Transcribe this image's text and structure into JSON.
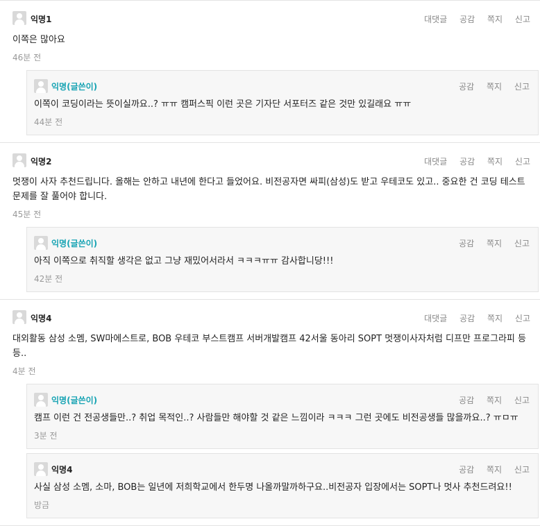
{
  "actions": {
    "reply": "대댓글",
    "like": "공감",
    "message": "쪽지",
    "report": "신고"
  },
  "comments": [
    {
      "author": "익명1",
      "text": "이쪽은 많아요",
      "time": "46분 전",
      "replies": [
        {
          "author": "익명(글쓴이)",
          "text": "이쪽이 코딩이라는 뜻이실까요..? ㅠㅠ 캠퍼스픽 이런 곳은 기자단 서포터즈 같은 것만 있길래요 ㅠㅠ",
          "time": "44분 전"
        }
      ]
    },
    {
      "author": "익명2",
      "text": "멋쟁이 사자 추천드립니다. 올해는 안하고 내년에 한다고 들었어요. 비전공자면 싸피(삼성)도 받고 우테코도 있고.. 중요한 건 코딩 테스트 문제를 잘 풀어야 합니다.",
      "time": "45분 전",
      "replies": [
        {
          "author": "익명(글쓴이)",
          "text": "아직 이쪽으로 취직할 생각은 없고 그냥 재밌어서라서 ㅋㅋㅋㅠㅠ 감사합니당!!!",
          "time": "42분 전"
        }
      ]
    },
    {
      "author": "익명4",
      "text": "대외활동 삼성 소멤, SW마에스트로, BOB 우테코 부스트캠프 서버개발캠프 42서울 동아리 SOPT 멋쟁이사자처럼 디프만 프로그라피 등등..",
      "time": "4분 전",
      "replies": [
        {
          "author": "익명(글쓴이)",
          "text": "캠프 이런 건 전공생들만..? 취업 목적인..? 사람들만 해야할 것 같은 느낌이라 ㅋㅋㅋ 그런 곳에도 비전공생들 많을까요..? ㅠㅁㅠ",
          "time": "3분 전"
        },
        {
          "author": "익명4",
          "text": "사실 삼성 소멤, 소마, BOB는 일년에 저희학교에서 한두명 나올까말까하구요..비전공자 입장에서는 SOPT나 멋사 추천드려요!!",
          "time": "방금"
        }
      ]
    }
  ]
}
